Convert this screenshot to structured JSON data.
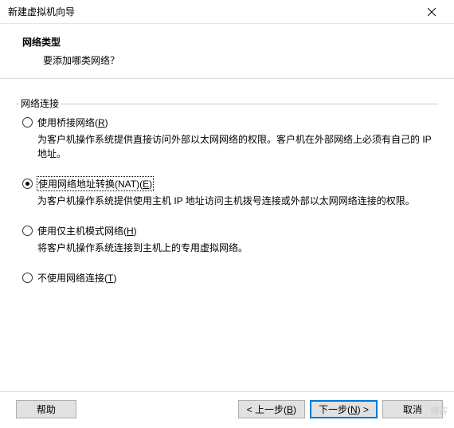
{
  "window": {
    "title": "新建虚拟机向导",
    "close_icon": "close"
  },
  "header": {
    "heading": "网络类型",
    "subtext": "要添加哪类网络？"
  },
  "fieldset": {
    "legend": "网络连接"
  },
  "options": [
    {
      "label_pre": "使用桥接网络(",
      "hotkey": "R",
      "label_post": ")",
      "desc": "为客户机操作系统提供直接访问外部以太网网络的权限。客户机在外部网络上必须有自己的 IP 地址。",
      "selected": false
    },
    {
      "label_pre": "使用网络地址转换(NAT)(",
      "hotkey": "E",
      "label_post": ")",
      "desc": "为客户机操作系统提供使用主机 IP 地址访问主机拨号连接或外部以太网网络连接的权限。",
      "selected": true
    },
    {
      "label_pre": "使用仅主机模式网络(",
      "hotkey": "H",
      "label_post": ")",
      "desc": "将客户机操作系统连接到主机上的专用虚拟网络。",
      "selected": false
    },
    {
      "label_pre": "不使用网络连接(",
      "hotkey": "T",
      "label_post": ")",
      "desc": "",
      "selected": false
    }
  ],
  "buttons": {
    "help": "帮助",
    "back_pre": "< 上一步(",
    "back_hotkey": "B",
    "back_post": ")",
    "next_pre": "下一步(",
    "next_hotkey": "N",
    "next_post": ") >",
    "cancel": "取消"
  },
  "watermark": "博客"
}
